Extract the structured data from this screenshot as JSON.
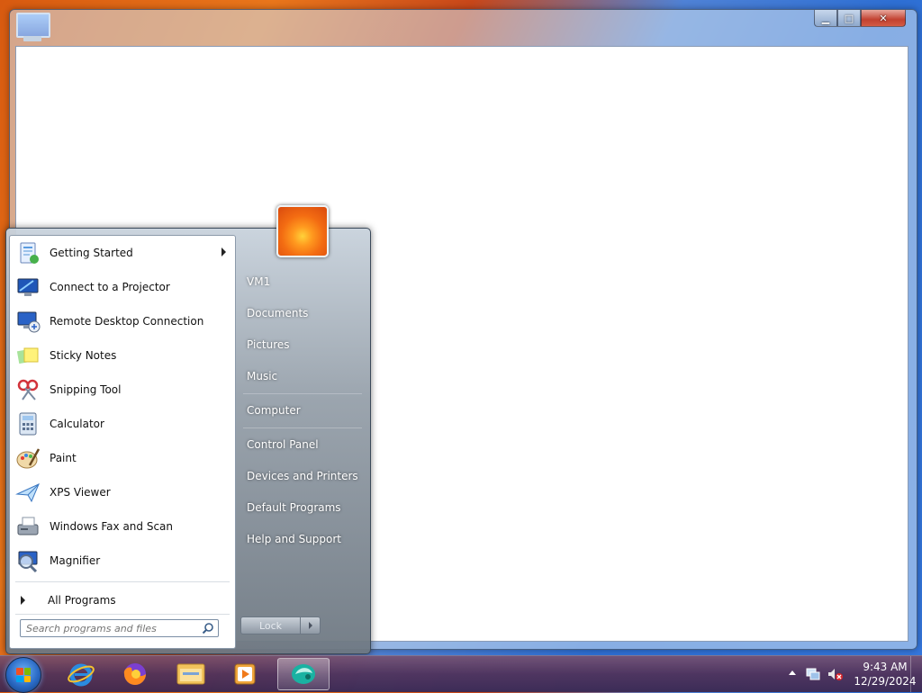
{
  "window": {
    "controls": {
      "minimize": "▁",
      "maximize": "□",
      "close": "✕"
    }
  },
  "start_menu": {
    "programs": [
      {
        "label": "Getting Started",
        "icon": "getting-started-icon",
        "has_submenu": true
      },
      {
        "label": "Connect to a Projector",
        "icon": "projector-icon"
      },
      {
        "label": "Remote Desktop Connection",
        "icon": "remote-desktop-icon"
      },
      {
        "label": "Sticky Notes",
        "icon": "sticky-notes-icon"
      },
      {
        "label": "Snipping Tool",
        "icon": "snipping-tool-icon"
      },
      {
        "label": "Calculator",
        "icon": "calculator-icon"
      },
      {
        "label": "Paint",
        "icon": "paint-icon"
      },
      {
        "label": "XPS Viewer",
        "icon": "xps-viewer-icon"
      },
      {
        "label": "Windows Fax and Scan",
        "icon": "fax-scan-icon"
      },
      {
        "label": "Magnifier",
        "icon": "magnifier-icon"
      }
    ],
    "all_programs": "All Programs",
    "search_placeholder": "Search programs and files",
    "right": {
      "user": "VM1",
      "documents": "Documents",
      "pictures": "Pictures",
      "music": "Music",
      "computer": "Computer",
      "control_panel": "Control Panel",
      "devices_printers": "Devices and Printers",
      "default_programs": "Default Programs",
      "help_support": "Help and Support"
    },
    "shutdown_label": "Lock"
  },
  "taskbar": {
    "pinned": [
      "internet-explorer-icon",
      "firefox-icon",
      "file-explorer-icon",
      "media-player-icon",
      "remote-desktop-app-icon"
    ],
    "clock_time": "9:43 AM",
    "clock_date": "12/29/2024"
  },
  "colors": {
    "taskbar": "#4f3760",
    "start_right_pane": "#8c96a0",
    "close_button": "#c24130"
  }
}
